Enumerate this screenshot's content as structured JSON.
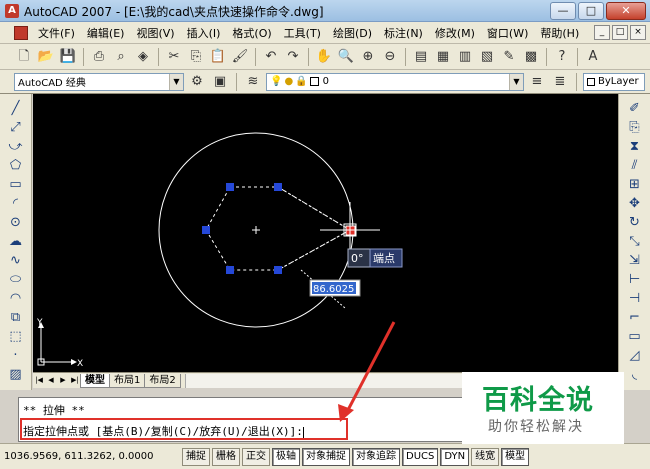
{
  "window": {
    "title": "AutoCAD 2007 - [E:\\我的cad\\夹点快速操作命令.dwg]",
    "app_icon": "autocad-icon",
    "buttons": {
      "minimize": "—",
      "maximize": "□",
      "close": "✕"
    }
  },
  "menu": {
    "items": [
      "文件(F)",
      "编辑(E)",
      "视图(V)",
      "插入(I)",
      "格式(O)",
      "工具(T)",
      "绘图(D)",
      "标注(N)",
      "修改(M)",
      "窗口(W)",
      "帮助(H)"
    ],
    "mdi_buttons": [
      "_",
      "□",
      "×"
    ]
  },
  "toolbar": {
    "icons": [
      "new-icon",
      "open-icon",
      "save-icon",
      "plot-icon",
      "preview-icon",
      "publish-icon",
      "cut-icon",
      "copy-icon",
      "paste-icon",
      "matchprop-icon",
      "undo-icon",
      "redo-icon",
      "pan-icon",
      "zoom-realtime-icon",
      "zoom-window-icon",
      "zoom-previous-icon",
      "properties-icon",
      "designcenter-icon",
      "toolpalettes-icon",
      "sheetset-icon",
      "markup-icon",
      "calculator-icon",
      "help-icon",
      "text-style-icon"
    ]
  },
  "toolbar2": {
    "workspace": "AutoCAD 经典",
    "layer_value": "0",
    "color_value": "ByLayer"
  },
  "canvas": {
    "dynamic_input_angle": "0°",
    "dynamic_input_tooltip": "端点",
    "dynamic_input_distance": "86.6025",
    "ucs_x": "X",
    "ucs_y": "Y"
  },
  "tabs": {
    "items": [
      "模型",
      "布局1",
      "布局2"
    ],
    "active": "模型"
  },
  "command": {
    "line1": "** 拉伸 **",
    "line2": "指定拉伸点或 [基点(B)/复制(C)/放弃(U)/退出(X)]:"
  },
  "status": {
    "coords": "1036.9569, 611.3262, 0.0000",
    "buttons": [
      "捕捉",
      "栅格",
      "正交",
      "极轴",
      "对象捕捉",
      "对象追踪",
      "DUCS",
      "DYN",
      "线宽",
      "模型"
    ],
    "on_buttons": [
      "极轴",
      "对象捕捉",
      "对象追踪",
      "DUCS",
      "DYN",
      "模型"
    ]
  },
  "watermark": {
    "title": "百科全说",
    "subtitle": "助你轻松解决"
  },
  "colors": {
    "canvas_bg": "#000000",
    "grip_selected": "#e0312a",
    "grip_unselected": "#2548d8",
    "annotation_red": "#e0312a",
    "watermark_green": "#0f9a48"
  }
}
